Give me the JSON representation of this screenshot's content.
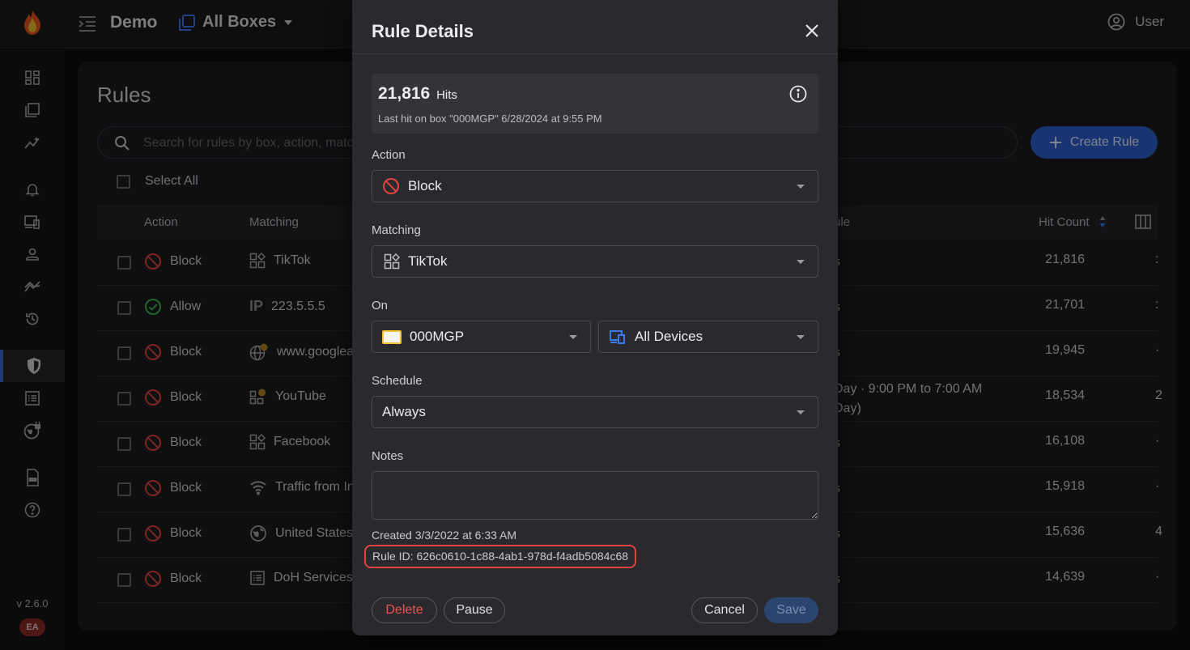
{
  "topbar": {
    "app_title": "Demo",
    "box_selector": "All Boxes",
    "user_label": "User"
  },
  "sidebar": {
    "version": "v 2.6.0",
    "badge": "EA",
    "items": [
      "dashboard-icon",
      "boxes-icon",
      "insights-icon",
      "alerts-icon",
      "devices-icon",
      "users-icon",
      "trends-icon",
      "history-icon",
      "rules-icon",
      "logs-icon",
      "global-security-icon",
      "api-icon",
      "help-icon"
    ]
  },
  "rules_page": {
    "title": "Rules",
    "search_placeholder": "Search for rules by box, action, matching, ...",
    "create_label": "Create Rule",
    "select_all_label": "Select All",
    "columns": {
      "action": "Action",
      "matching": "Matching",
      "schedule": "ule",
      "hit_count": "Hit Count"
    },
    "rows": [
      {
        "action": "Block",
        "matching": "TikTok",
        "match_icon": "app",
        "schedule": "s",
        "hits": "21,816",
        "trail": ":"
      },
      {
        "action": "Allow",
        "matching": "223.5.5.5",
        "match_icon": "ip",
        "schedule": "s",
        "hits": "21,701",
        "trail": ":"
      },
      {
        "action": "Block",
        "matching": "www.googlea",
        "match_icon": "domain",
        "schedule": "s",
        "hits": "19,945",
        "trail": "·"
      },
      {
        "action": "Block",
        "matching": "YouTube",
        "match_icon": "app-badge",
        "schedule": "Day · 9:00 PM to 7:00 AM",
        "schedule2": "Day)",
        "hits": "18,534",
        "trail": "2"
      },
      {
        "action": "Block",
        "matching": "Facebook",
        "match_icon": "app",
        "schedule": "s",
        "hits": "16,108",
        "trail": "·"
      },
      {
        "action": "Block",
        "matching": "Traffic from In",
        "match_icon": "wifi",
        "schedule": "s",
        "hits": "15,918",
        "trail": "·"
      },
      {
        "action": "Block",
        "matching": "United States",
        "match_icon": "globe",
        "schedule": "s",
        "hits": "15,636",
        "trail": "4"
      },
      {
        "action": "Block",
        "matching": "DoH Services",
        "match_icon": "list",
        "schedule": "s",
        "hits": "14,639",
        "trail": "·"
      }
    ]
  },
  "modal": {
    "title": "Rule Details",
    "hits_count": "21,816",
    "hits_unit": "Hits",
    "last_hit": "Last hit on box \"000MGP\" 6/28/2024 at 9:55 PM",
    "action_label": "Action",
    "action_value": "Block",
    "matching_label": "Matching",
    "matching_value": "TikTok",
    "on_label": "On",
    "box_value": "000MGP",
    "devices_value": "All Devices",
    "schedule_label": "Schedule",
    "schedule_value": "Always",
    "notes_label": "Notes",
    "notes_value": "",
    "created": "Created 3/3/2022 at 6:33 AM",
    "rule_id": "Rule ID: 626c0610-1c88-4ab1-978d-f4adb5084c68",
    "delete_label": "Delete",
    "pause_label": "Pause",
    "cancel_label": "Cancel",
    "save_label": "Save"
  },
  "colors": {
    "accent": "#2f5fd1",
    "block": "#e2423f",
    "allow": "#3fb950",
    "highlight": "#e2423f"
  }
}
